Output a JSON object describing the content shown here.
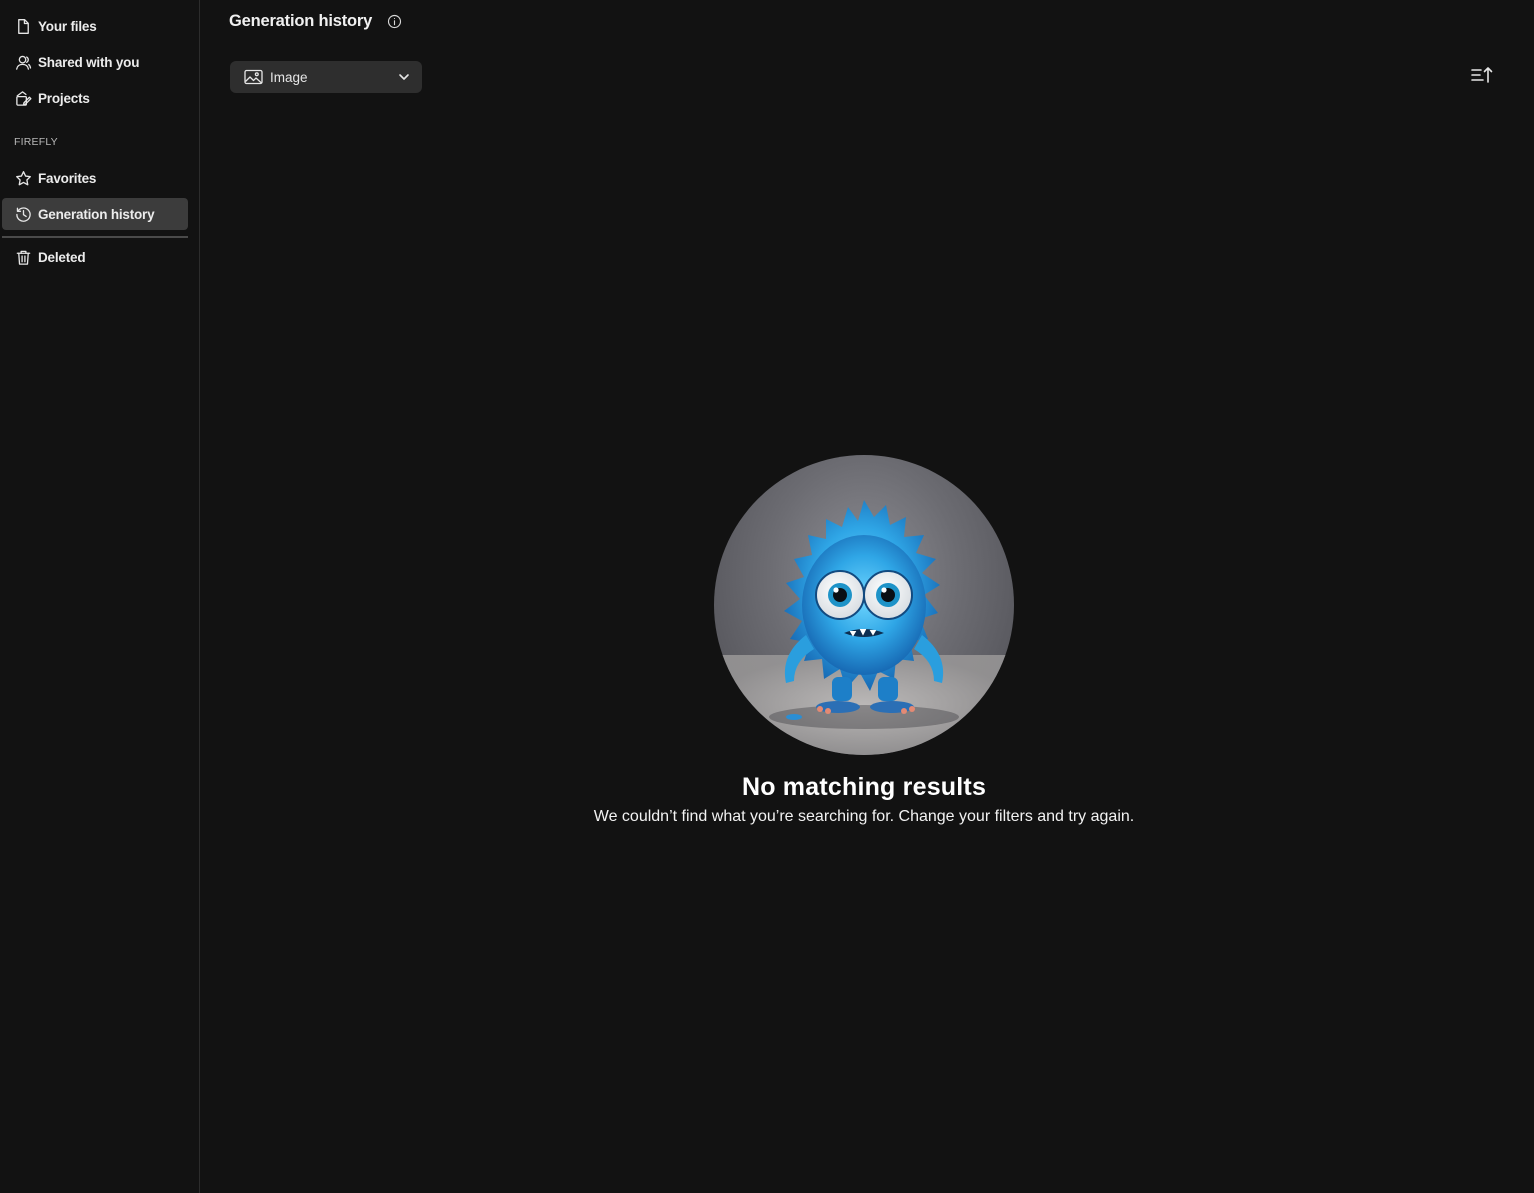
{
  "sidebar": {
    "items": [
      {
        "label": "Your files",
        "icon": "file-icon"
      },
      {
        "label": "Shared with you",
        "icon": "person-icon"
      },
      {
        "label": "Projects",
        "icon": "projects-icon"
      }
    ],
    "section_label": "FIREFLY",
    "firefly_items": [
      {
        "label": "Favorites",
        "icon": "star-icon"
      },
      {
        "label": "Generation history",
        "icon": "history-icon",
        "active": true
      }
    ],
    "bottom_items": [
      {
        "label": "Deleted",
        "icon": "trash-icon"
      }
    ]
  },
  "header": {
    "title": "Generation history",
    "info_icon": "info-icon"
  },
  "filter": {
    "selected": "Image",
    "icon": "image-icon"
  },
  "toolbar": {
    "sort_icon": "sort-ascending-icon"
  },
  "empty_state": {
    "title": "No matching results",
    "message": "We couldn’t find what you’re searching for. Change your filters and try again.",
    "illustration": "blue-furry-monster-illustration"
  },
  "colors": {
    "background": "#121212",
    "active_item": "#3c3c3c",
    "select_bg": "#2e2e2e",
    "monster": "#3fb8ef"
  }
}
